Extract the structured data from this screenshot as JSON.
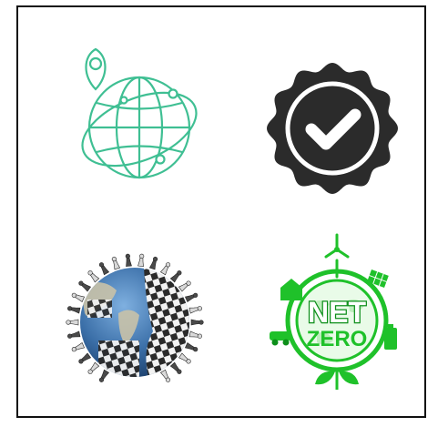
{
  "colors": {
    "frame_border": "#111111",
    "globe_pin_stroke": "#3fbf93",
    "badge_fill": "#2b2b2b",
    "badge_check": "#ffffff",
    "netzero_green": "#1fc12a",
    "netzero_dark_green": "#0d8f1a",
    "chess_globe_ocean": "#3b6fa8",
    "chess_globe_land": "#c9c2a8"
  },
  "icons": [
    {
      "name": "globe-location-pin-icon",
      "position": "top-left"
    },
    {
      "name": "verified-badge-check-icon",
      "position": "top-right"
    },
    {
      "name": "chess-globe-icon",
      "position": "bottom-left"
    },
    {
      "name": "net-zero-emblem-icon",
      "position": "bottom-right"
    }
  ],
  "netzero": {
    "line1": "NET",
    "line2": "ZERO"
  }
}
